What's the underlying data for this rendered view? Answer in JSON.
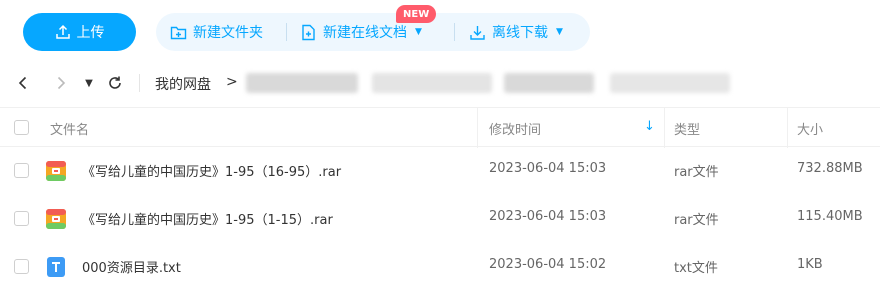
{
  "toolbar": {
    "upload_label": "上传",
    "new_folder_label": "新建文件夹",
    "new_online_doc_label": "新建在线文档",
    "new_badge": "NEW",
    "offline_download_label": "离线下载"
  },
  "breadcrumb": {
    "root": "我的网盘",
    "arrow": ">"
  },
  "table": {
    "columns": {
      "name": "文件名",
      "modified": "修改时间",
      "type": "类型",
      "size": "大小"
    },
    "rows": [
      {
        "name": "《写给儿童的中国历史》1-95（16-95）.rar",
        "modified": "2023-06-04 15:03",
        "type": "rar文件",
        "size": "732.88MB",
        "icon": "archive-icon"
      },
      {
        "name": "《写给儿童的中国历史》1-95（1-15）.rar",
        "modified": "2023-06-04 15:03",
        "type": "rar文件",
        "size": "115.40MB",
        "icon": "archive-icon"
      },
      {
        "name": "000资源目录.txt",
        "modified": "2023-06-04 15:02",
        "type": "txt文件",
        "size": "1KB",
        "icon": "text-file-icon"
      }
    ]
  },
  "colors": {
    "accent": "#06a7ff",
    "toolbar_bg": "#eef7fe",
    "badge": "#ff5b6b"
  }
}
